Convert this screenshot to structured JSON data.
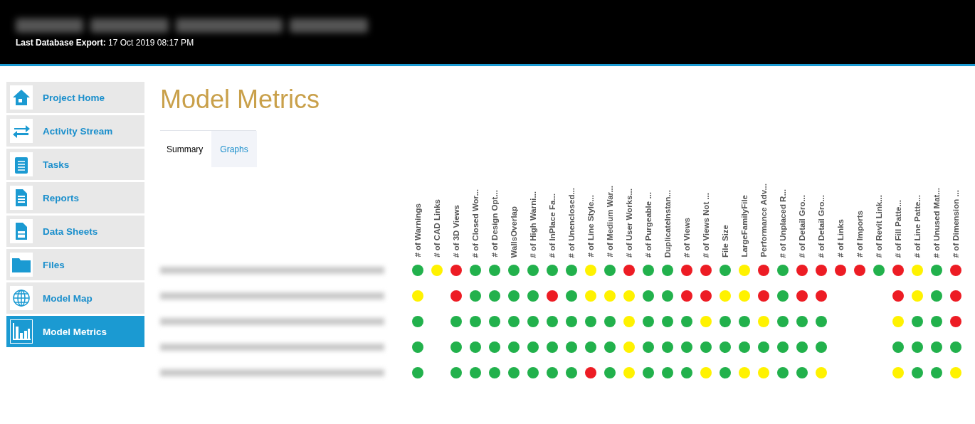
{
  "header": {
    "export_label": "Last Database Export:",
    "export_value": "17 Oct 2019 08:17 PM"
  },
  "sidebar": {
    "items": [
      {
        "label": "Project Home",
        "selected": false
      },
      {
        "label": "Activity Stream",
        "selected": false
      },
      {
        "label": "Tasks",
        "selected": false
      },
      {
        "label": "Reports",
        "selected": false
      },
      {
        "label": "Data Sheets",
        "selected": false
      },
      {
        "label": "Files",
        "selected": false
      },
      {
        "label": "Model Map",
        "selected": false
      },
      {
        "label": "Model Metrics",
        "selected": true
      }
    ]
  },
  "page_title": "Model Metrics",
  "tabs": [
    {
      "label": "Summary",
      "selected": true
    },
    {
      "label": "Graphs",
      "selected": false
    }
  ],
  "table": {
    "columns": [
      "# of Warnings",
      "# of CAD Links",
      "# of 3D Views",
      "# of Closed Wor...",
      "# of Design Opt...",
      "WallsOverlap",
      "# of High Warni...",
      "# of InPlace Fa...",
      "# of Unenclosed...",
      "# of Line Style...",
      "# of Medium War...",
      "# of User Works...",
      "# of Purgeable ...",
      "DuplicateInstan...",
      "# of Views",
      "# of Views Not ...",
      "File Size",
      "LargeFamilyFile",
      "Performance Adv...",
      "# of Unplaced R...",
      "# of Detail Gro...",
      "# of Detail Gro...",
      "# of Links",
      "# of Imports",
      "# of Revit Link...",
      "# of Fill Patte...",
      "# of Line Patte...",
      "# of Unused Mat...",
      "# of Dimension ..."
    ],
    "rows": [
      {
        "cells": [
          {
            "color": "#22b14c"
          },
          {
            "color": "#fff200"
          },
          {
            "color": "#ed1c24"
          },
          {
            "color": "#22b14c"
          },
          {
            "color": "#22b14c"
          },
          {
            "color": "#22b14c"
          },
          {
            "color": "#22b14c"
          },
          {
            "color": "#22b14c"
          },
          {
            "color": "#22b14c"
          },
          {
            "color": "#fff200"
          },
          {
            "color": "#22b14c"
          },
          {
            "color": "#ed1c24"
          },
          {
            "color": "#22b14c"
          },
          {
            "color": "#22b14c"
          },
          {
            "color": "#ed1c24"
          },
          {
            "color": "#ed1c24"
          },
          {
            "color": "#22b14c"
          },
          {
            "color": "#fff200"
          },
          {
            "color": "#ed1c24"
          },
          {
            "color": "#22b14c"
          },
          {
            "color": "#ed1c24"
          },
          {
            "color": "#ed1c24"
          },
          {
            "color": "#ed1c24"
          },
          {
            "color": "#ed1c24"
          },
          {
            "color": "#22b14c"
          },
          {
            "color": "#ed1c24"
          },
          {
            "color": "#fff200"
          },
          {
            "color": "#22b14c"
          },
          {
            "color": "#ed1c24"
          }
        ]
      },
      {
        "cells": [
          {
            "color": "#fff200"
          },
          null,
          {
            "color": "#ed1c24"
          },
          {
            "color": "#22b14c"
          },
          {
            "color": "#22b14c"
          },
          {
            "color": "#22b14c"
          },
          {
            "color": "#22b14c"
          },
          {
            "color": "#ed1c24"
          },
          {
            "color": "#22b14c"
          },
          {
            "color": "#fff200"
          },
          {
            "color": "#fff200"
          },
          {
            "color": "#fff200"
          },
          {
            "color": "#22b14c"
          },
          {
            "color": "#22b14c"
          },
          {
            "color": "#ed1c24"
          },
          {
            "color": "#ed1c24"
          },
          {
            "color": "#fff200"
          },
          {
            "color": "#fff200"
          },
          {
            "color": "#ed1c24"
          },
          {
            "color": "#22b14c"
          },
          {
            "color": "#ed1c24"
          },
          {
            "color": "#ed1c24"
          },
          null,
          null,
          null,
          {
            "color": "#ed1c24"
          },
          {
            "color": "#fff200"
          },
          {
            "color": "#22b14c"
          },
          {
            "color": "#ed1c24"
          }
        ]
      },
      {
        "cells": [
          {
            "color": "#22b14c"
          },
          null,
          {
            "color": "#22b14c"
          },
          {
            "color": "#22b14c"
          },
          {
            "color": "#22b14c"
          },
          {
            "color": "#22b14c"
          },
          {
            "color": "#22b14c"
          },
          {
            "color": "#22b14c"
          },
          {
            "color": "#22b14c"
          },
          {
            "color": "#22b14c"
          },
          {
            "color": "#22b14c"
          },
          {
            "color": "#fff200"
          },
          {
            "color": "#22b14c"
          },
          {
            "color": "#22b14c"
          },
          {
            "color": "#22b14c"
          },
          {
            "color": "#fff200"
          },
          {
            "color": "#22b14c"
          },
          {
            "color": "#22b14c"
          },
          {
            "color": "#fff200"
          },
          {
            "color": "#22b14c"
          },
          {
            "color": "#22b14c"
          },
          {
            "color": "#22b14c"
          },
          null,
          null,
          null,
          {
            "color": "#fff200"
          },
          {
            "color": "#22b14c"
          },
          {
            "color": "#22b14c"
          },
          {
            "color": "#ed1c24"
          }
        ]
      },
      {
        "cells": [
          {
            "color": "#22b14c"
          },
          null,
          {
            "color": "#22b14c"
          },
          {
            "color": "#22b14c"
          },
          {
            "color": "#22b14c"
          },
          {
            "color": "#22b14c"
          },
          {
            "color": "#22b14c"
          },
          {
            "color": "#22b14c"
          },
          {
            "color": "#22b14c"
          },
          {
            "color": "#22b14c"
          },
          {
            "color": "#22b14c"
          },
          {
            "color": "#fff200"
          },
          {
            "color": "#22b14c"
          },
          {
            "color": "#22b14c"
          },
          {
            "color": "#22b14c"
          },
          {
            "color": "#22b14c"
          },
          {
            "color": "#22b14c"
          },
          {
            "color": "#22b14c"
          },
          {
            "color": "#22b14c"
          },
          {
            "color": "#22b14c"
          },
          {
            "color": "#22b14c"
          },
          {
            "color": "#22b14c"
          },
          null,
          null,
          null,
          {
            "color": "#22b14c"
          },
          {
            "color": "#22b14c"
          },
          {
            "color": "#22b14c"
          },
          {
            "color": "#22b14c"
          }
        ]
      },
      {
        "cells": [
          {
            "color": "#22b14c"
          },
          null,
          {
            "color": "#22b14c"
          },
          {
            "color": "#22b14c"
          },
          {
            "color": "#22b14c"
          },
          {
            "color": "#22b14c"
          },
          {
            "color": "#22b14c"
          },
          {
            "color": "#22b14c"
          },
          {
            "color": "#22b14c"
          },
          {
            "color": "#ed1c24"
          },
          {
            "color": "#22b14c"
          },
          {
            "color": "#fff200"
          },
          {
            "color": "#22b14c"
          },
          {
            "color": "#22b14c"
          },
          {
            "color": "#22b14c"
          },
          {
            "color": "#fff200"
          },
          {
            "color": "#22b14c"
          },
          {
            "color": "#fff200"
          },
          {
            "color": "#fff200"
          },
          {
            "color": "#22b14c"
          },
          {
            "color": "#22b14c"
          },
          {
            "color": "#fff200"
          },
          null,
          null,
          null,
          {
            "color": "#fff200"
          },
          {
            "color": "#22b14c"
          },
          {
            "color": "#22b14c"
          },
          {
            "color": "#fff200"
          }
        ]
      }
    ]
  }
}
